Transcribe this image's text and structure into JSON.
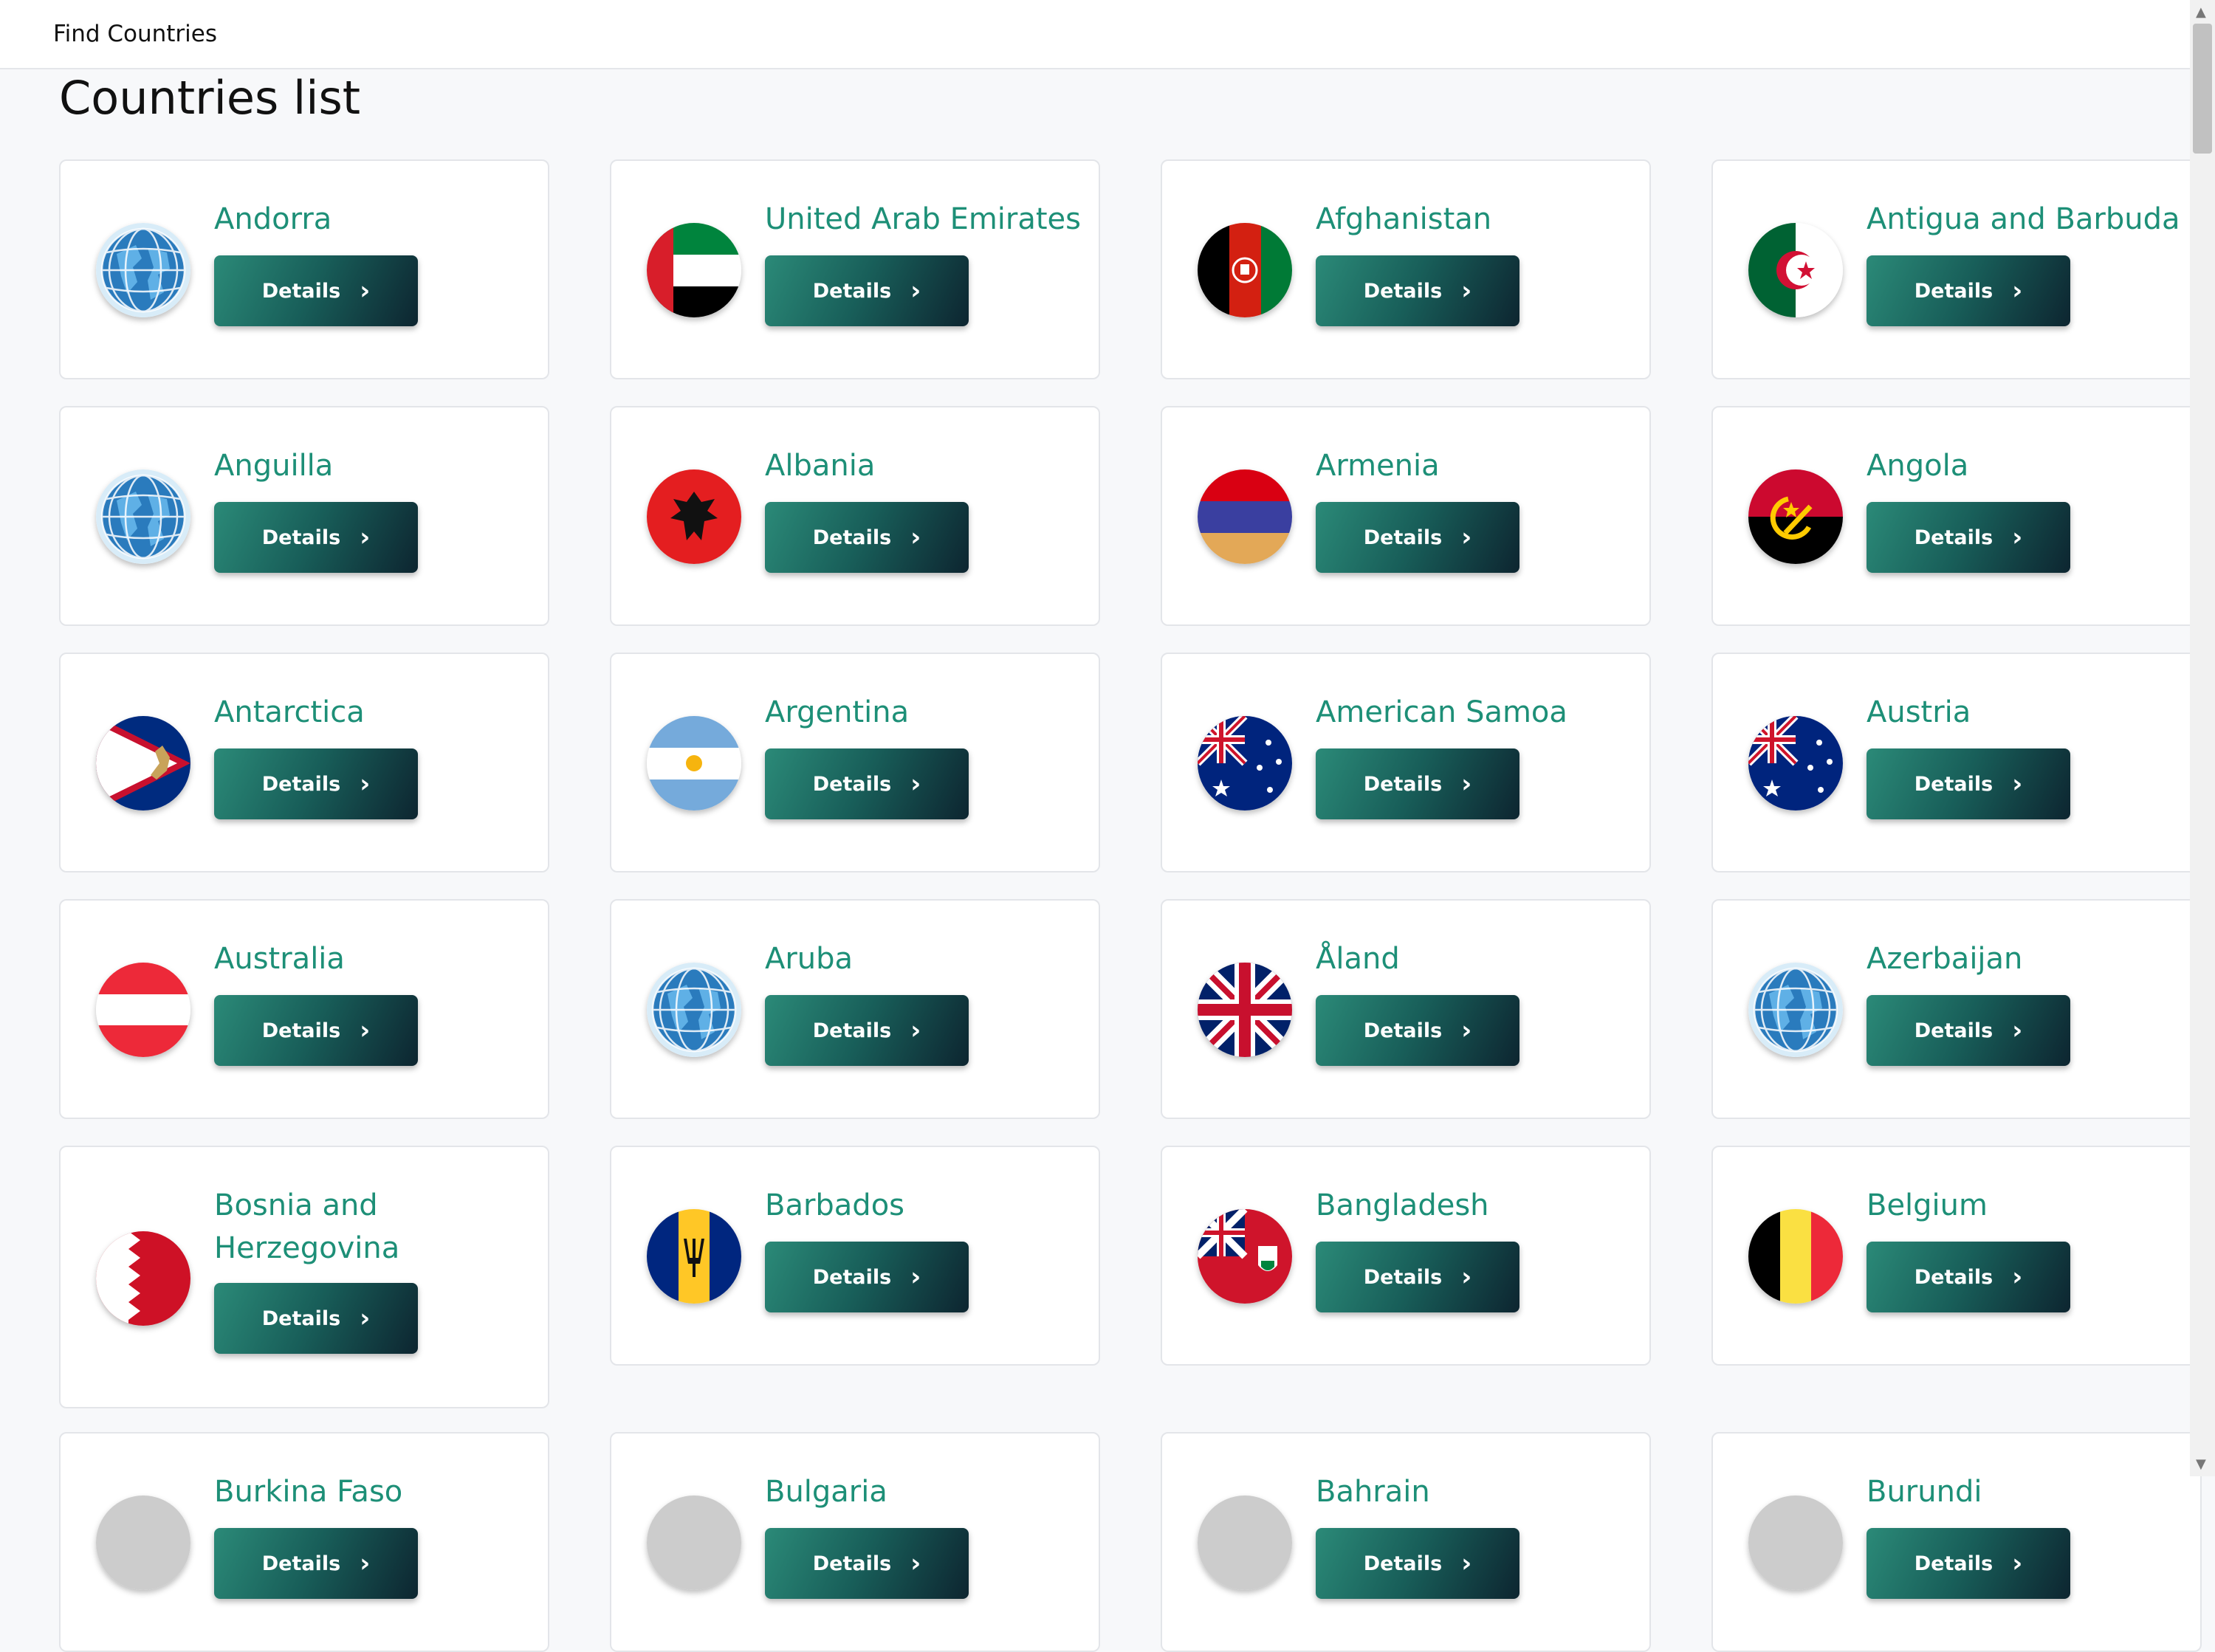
{
  "navbar": {
    "brand": "Find Countries"
  },
  "page": {
    "title": "Countries list",
    "button_label": "Details"
  },
  "countries": [
    {
      "name": "Andorra",
      "flag": "globe-icon"
    },
    {
      "name": "United Arab Emirates",
      "flag": "uae-flag-icon"
    },
    {
      "name": "Afghanistan",
      "flag": "afghanistan-flag-icon"
    },
    {
      "name": "Antigua and Barbuda",
      "flag": "algeria-flag-icon"
    },
    {
      "name": "Anguilla",
      "flag": "globe-icon"
    },
    {
      "name": "Albania",
      "flag": "albania-flag-icon"
    },
    {
      "name": "Armenia",
      "flag": "armenia-flag-icon"
    },
    {
      "name": "Angola",
      "flag": "angola-flag-icon"
    },
    {
      "name": "Antarctica",
      "flag": "american-samoa-flag-icon"
    },
    {
      "name": "Argentina",
      "flag": "argentina-flag-icon"
    },
    {
      "name": "American Samoa",
      "flag": "australia-flag-icon"
    },
    {
      "name": "Austria",
      "flag": "australia-flag-icon"
    },
    {
      "name": "Australia",
      "flag": "austria-flag-icon"
    },
    {
      "name": "Aruba",
      "flag": "globe-icon"
    },
    {
      "name": "Åland",
      "flag": "uk-flag-icon"
    },
    {
      "name": "Azerbaijan",
      "flag": "globe-icon"
    },
    {
      "name": "Bosnia and Herzegovina",
      "flag": "bahrain-flag-icon"
    },
    {
      "name": "Barbados",
      "flag": "barbados-flag-icon"
    },
    {
      "name": "Bangladesh",
      "flag": "bermuda-flag-icon"
    },
    {
      "name": "Belgium",
      "flag": "belgium-flag-icon"
    },
    {
      "name": "Burkina Faso",
      "flag": "unknown-flag-icon"
    },
    {
      "name": "Bulgaria",
      "flag": "unknown-flag-icon"
    },
    {
      "name": "Bahrain",
      "flag": "unknown-flag-icon"
    },
    {
      "name": "Burundi",
      "flag": "unknown-flag-icon"
    }
  ],
  "colors": {
    "accent": "#1d8f77",
    "button_start": "#2b8a78",
    "button_end": "#0d2530"
  }
}
